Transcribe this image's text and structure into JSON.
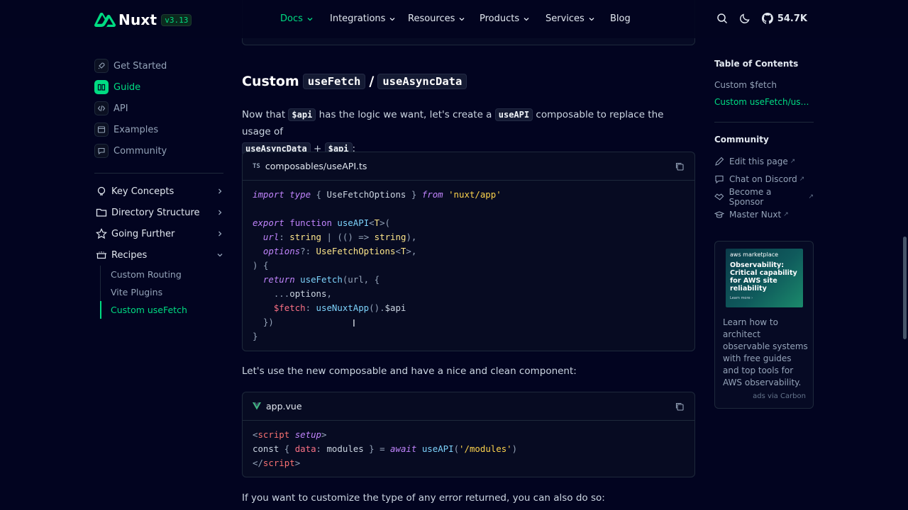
{
  "header": {
    "logo_text": "Nuxt",
    "version": "v3.13",
    "nav": [
      {
        "label": "Docs",
        "active": true
      },
      {
        "label": "Integrations"
      },
      {
        "label": "Resources"
      },
      {
        "label": "Products"
      },
      {
        "label": "Services"
      },
      {
        "label": "Blog"
      }
    ],
    "github_stars": "54.7K"
  },
  "sidebar": {
    "links": [
      {
        "label": "Get Started"
      },
      {
        "label": "Guide",
        "active": true
      },
      {
        "label": "API"
      },
      {
        "label": "Examples"
      },
      {
        "label": "Community"
      }
    ],
    "groups": [
      {
        "label": "Key Concepts"
      },
      {
        "label": "Directory Structure"
      },
      {
        "label": "Going Further"
      },
      {
        "label": "Recipes"
      }
    ],
    "recipes": [
      {
        "label": "Custom Routing"
      },
      {
        "label": "Vite Plugins"
      },
      {
        "label": "Custom useFetch",
        "active": true
      }
    ]
  },
  "main": {
    "heading_prefix": "Custom",
    "heading_code1": "useFetch",
    "heading_sep": "/",
    "heading_code2": "useAsyncData",
    "para1": {
      "t1": "Now that",
      "c1": "$api",
      "t2": "has the logic we want, let's create a",
      "c2": "useAPI",
      "t3": "composable to replace the usage of",
      "c3": "useAsyncData",
      "t4": "+",
      "c4": "$api",
      "t5": ":"
    },
    "code1": {
      "lang": "TS",
      "filename": "composables/useAPI.ts"
    },
    "para2": "Let's use the new composable and have a nice and clean component:",
    "code2": {
      "filename": "app.vue"
    },
    "para3": "If you want to customize the type of any error returned, you can also do so:"
  },
  "toc": {
    "title": "Table of Contents",
    "links": [
      {
        "label": "Custom $fetch"
      },
      {
        "label": "Custom useFetch/useA...",
        "active": true
      }
    ],
    "community_title": "Community",
    "community": [
      {
        "label": "Edit this page",
        "icon": "edit-icon"
      },
      {
        "label": "Chat on Discord",
        "icon": "chat-icon"
      },
      {
        "label": "Become a Sponsor",
        "icon": "handshake-icon"
      },
      {
        "label": "Master Nuxt",
        "icon": "hat-icon"
      }
    ]
  },
  "ad": {
    "brand": "aws marketplace",
    "headline": "Observability: Critical capability for AWS site reliability",
    "cta": "Learn more ›",
    "text": "Learn how to architect observable systems with free guides and top tools for AWS observability.",
    "via": "ads via Carbon"
  },
  "colors": {
    "accent": "#00dc82",
    "background": "#020420"
  }
}
